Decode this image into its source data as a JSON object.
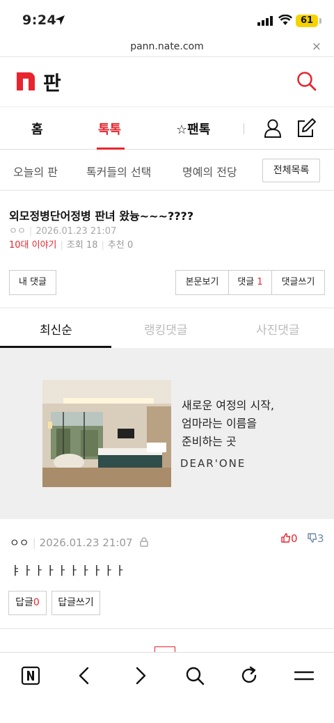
{
  "status_bar": {
    "time": "9:24",
    "battery": "61"
  },
  "browser": {
    "url": "pann.nate.com",
    "close_label": "×"
  },
  "header": {
    "logo_text": "판"
  },
  "main_nav": {
    "items": [
      {
        "label": "홈"
      },
      {
        "label": "톡톡"
      },
      {
        "label": "☆팬톡"
      }
    ]
  },
  "sub_nav": {
    "items": [
      {
        "label": "오늘의 판"
      },
      {
        "label": "톡커들의 선택"
      },
      {
        "label": "명예의 전당"
      }
    ],
    "all_button": "전체목록"
  },
  "post": {
    "title": "외모정병단어정병 판녀 왔늉~~~????",
    "author": "ㅇㅇ",
    "datetime": "2026.01.23 21:07",
    "category": "10대 이야기",
    "views_label": "조회",
    "views": "18",
    "recommend_label": "추천",
    "recommend": "0"
  },
  "post_actions": {
    "my_comments": "내 댓글",
    "view_body": "본문보기",
    "comments_label": "댓글",
    "comments_count": "1",
    "write_comment": "댓글쓰기"
  },
  "comment_tabs": [
    {
      "label": "최신순"
    },
    {
      "label": "랭킹댓글"
    },
    {
      "label": "사진댓글"
    }
  ],
  "ad": {
    "line1": "새로운 여정의 시작,",
    "line2": "엄마라는 이름을",
    "line3": "준비하는 곳",
    "brand": "DEAR'ONE"
  },
  "comment": {
    "author": "ㅇㅇ",
    "datetime": "2026.01.23 21:07",
    "likes": "0",
    "dislikes": "3",
    "body": "ㅑㅏㅏㅏㅏㅏㅏㅏㅏㅏ",
    "reply_label": "답글",
    "reply_count": "0",
    "write_reply": "답글쓰기"
  },
  "colors": {
    "accent": "#e8242e",
    "dislike": "#6e8aa6"
  }
}
